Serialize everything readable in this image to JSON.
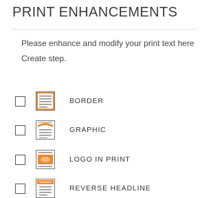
{
  "header": {
    "title": "PRINT ENHANCEMENTS"
  },
  "instructions": {
    "line1": "Please enhance and modify your print text here",
    "line2": "Create step."
  },
  "options": [
    {
      "label": "BORDER",
      "icon": "border-thumbnail-icon",
      "checked": false
    },
    {
      "label": "GRAPHIC",
      "icon": "graphic-thumbnail-icon",
      "checked": false
    },
    {
      "label": "LOGO IN PRINT",
      "icon": "logo-thumbnail-icon",
      "checked": false
    },
    {
      "label": "REVERSE HEADLINE",
      "icon": "reverse-headline-thumbnail-icon",
      "checked": false
    }
  ],
  "colors": {
    "accent": "#f0892b",
    "text": "#333333",
    "divider": "#e2e2e2"
  }
}
